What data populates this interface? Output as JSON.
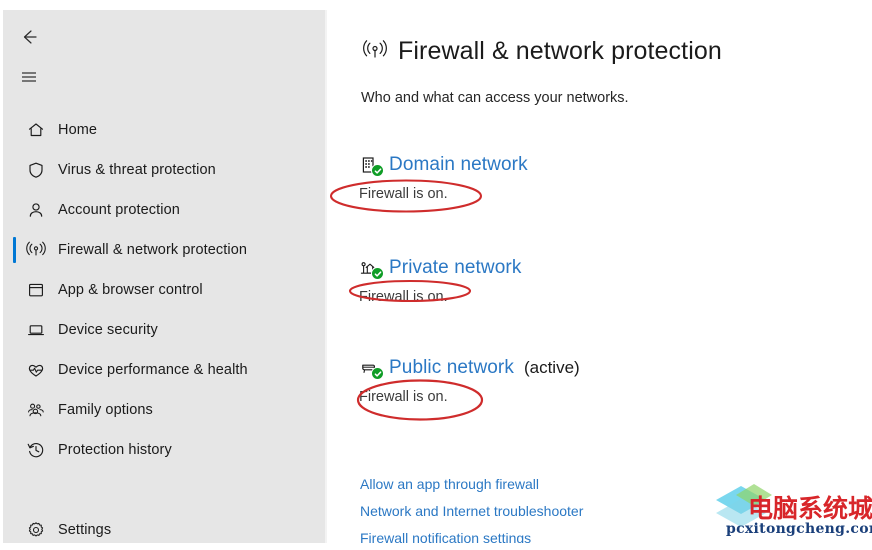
{
  "window": {
    "sidebar_bg": "#e6e6e6",
    "accent": "#0078d4",
    "link_color": "#2b78c4",
    "annotation_color": "#d42a2a",
    "status_ok_color": "#0f9d26"
  },
  "sidebar": {
    "back_icon": "back-arrow-icon",
    "menu_icon": "hamburger-menu-icon",
    "items": [
      {
        "label": "Home",
        "icon": "home-icon",
        "selected": false
      },
      {
        "label": "Virus & threat protection",
        "icon": "shield-icon",
        "selected": false
      },
      {
        "label": "Account protection",
        "icon": "person-icon",
        "selected": false
      },
      {
        "label": "Firewall & network protection",
        "icon": "wifi-broadcast-icon",
        "selected": true
      },
      {
        "label": "App & browser control",
        "icon": "app-window-icon",
        "selected": false
      },
      {
        "label": "Device security",
        "icon": "laptop-icon",
        "selected": false
      },
      {
        "label": "Device performance & health",
        "icon": "heartbeat-icon",
        "selected": false
      },
      {
        "label": "Family options",
        "icon": "family-people-icon",
        "selected": false
      },
      {
        "label": "Protection history",
        "icon": "history-clock-icon",
        "selected": false
      }
    ],
    "settings": {
      "label": "Settings",
      "icon": "gear-icon"
    }
  },
  "main": {
    "title": "Firewall & network protection",
    "title_icon": "wifi-broadcast-icon",
    "subtitle": "Who and what can access your networks.",
    "networks": [
      {
        "name": "Domain network",
        "icon": "building-icon",
        "badge": "green-check-badge",
        "status": "Firewall is on.",
        "active_tag": "",
        "annotated": true
      },
      {
        "name": "Private network",
        "icon": "house-icon",
        "badge": "green-check-badge",
        "status": "Firewall is on.",
        "active_tag": "",
        "annotated": true
      },
      {
        "name": "Public network",
        "icon": "park-bench-icon",
        "badge": "green-check-badge",
        "status": "Firewall is on.",
        "active_tag": "(active)",
        "annotated": true
      }
    ],
    "links": [
      {
        "label": "Allow an app through firewall"
      },
      {
        "label": "Network and Internet troubleshooter"
      },
      {
        "label": "Firewall notification settings"
      }
    ]
  },
  "watermark": {
    "cn_text": "电脑系统城",
    "en_text": "pcxitongcheng.com"
  }
}
